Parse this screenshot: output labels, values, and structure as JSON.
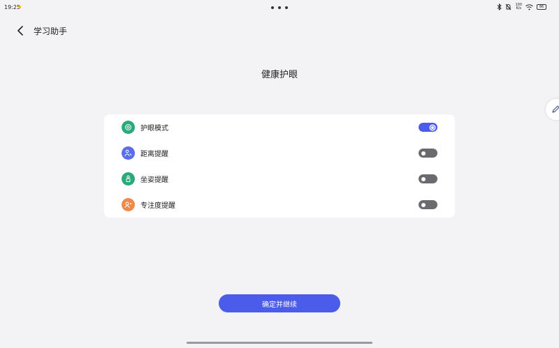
{
  "status_bar": {
    "time": "19:25",
    "speed_value": "100",
    "speed_unit": "K/s",
    "battery": "86"
  },
  "header": {
    "title": "学习助手"
  },
  "page_title": "健康护眼",
  "settings": [
    {
      "label": "护眼模式",
      "icon": "eye-icon",
      "color": "#2aa97a",
      "enabled": true
    },
    {
      "label": "距离提醒",
      "icon": "distance-person-icon",
      "color": "#5a6cf0",
      "enabled": false
    },
    {
      "label": "坐姿提醒",
      "icon": "posture-icon",
      "color": "#2aa97a",
      "enabled": false
    },
    {
      "label": "专注度提醒",
      "icon": "focus-icon",
      "color": "#f08a4b",
      "enabled": false
    }
  ],
  "confirm_label": "确定并继续",
  "colors": {
    "accent": "#4b5bea",
    "background": "#f3f3f5",
    "card": "#ffffff"
  }
}
